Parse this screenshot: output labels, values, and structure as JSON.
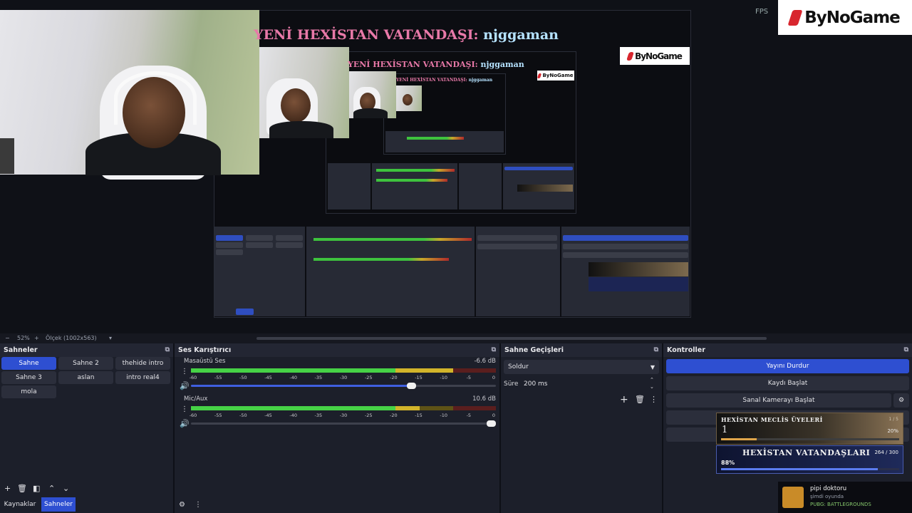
{
  "preview": {
    "ticker_prefix": "YENİ HEXİSTAN VATANDAŞI:",
    "ticker_name": "njggaman",
    "brand": "ByNoGame",
    "fps_label": "FPS"
  },
  "zoom": {
    "zoom_out": "−",
    "zoom_level": "52%",
    "zoom_in": "+",
    "scale_label": "Ölçek (1002x563)",
    "scale_dropdown": "▾"
  },
  "scenes": {
    "title": "Sahneler",
    "items": [
      "Sahne",
      "Sahne 2",
      "thehide intro",
      "Sahne 3",
      "aslan",
      "intro real4",
      "mola"
    ],
    "active_index": 0
  },
  "mixer": {
    "title": "Ses Karıştırıcı",
    "channels": [
      {
        "name": "Masaüstü Ses",
        "db": "-6.6 dB",
        "level": 0.86,
        "volume": 0.73
      },
      {
        "name": "Mic/Aux",
        "db": "10.6 dB",
        "level": 0.75,
        "volume": 1.0
      }
    ],
    "ticks": [
      "-60",
      "-55",
      "-50",
      "-45",
      "-40",
      "-35",
      "-30",
      "-25",
      "-20",
      "-15",
      "-10",
      "-5",
      "0"
    ]
  },
  "transitions": {
    "title": "Sahne Geçişleri",
    "selected": "Soldur",
    "duration_label": "Süre",
    "duration_value": "200 ms"
  },
  "controls": {
    "title": "Kontroller",
    "stop_stream": "Yayını Durdur",
    "start_recording": "Kaydı Başlat",
    "start_virtual_cam": "Sanal Kamerayı Başlat"
  },
  "tabs": {
    "sources": "Kaynaklar",
    "scenes": "Sahneler"
  },
  "overlay_meclis": {
    "title": "HEXİSTAN MECLİS ÜYELERİ",
    "count": "1 / 5",
    "value": "1",
    "percent": "20%",
    "fraction": 0.2
  },
  "overlay_vatandas": {
    "title": "HEXİSTAN VATANDAŞLARI",
    "count": "264 / 300",
    "percent": "88%",
    "fraction": 0.88
  },
  "notification": {
    "name": "pipi doktoru",
    "status": "şimdi oyunda",
    "game": "PUBG: BATTLEGROUNDS"
  },
  "colors": {
    "accent": "#2e4fd1",
    "panel": "#1c1f2a",
    "brand_red": "#d8262e"
  }
}
